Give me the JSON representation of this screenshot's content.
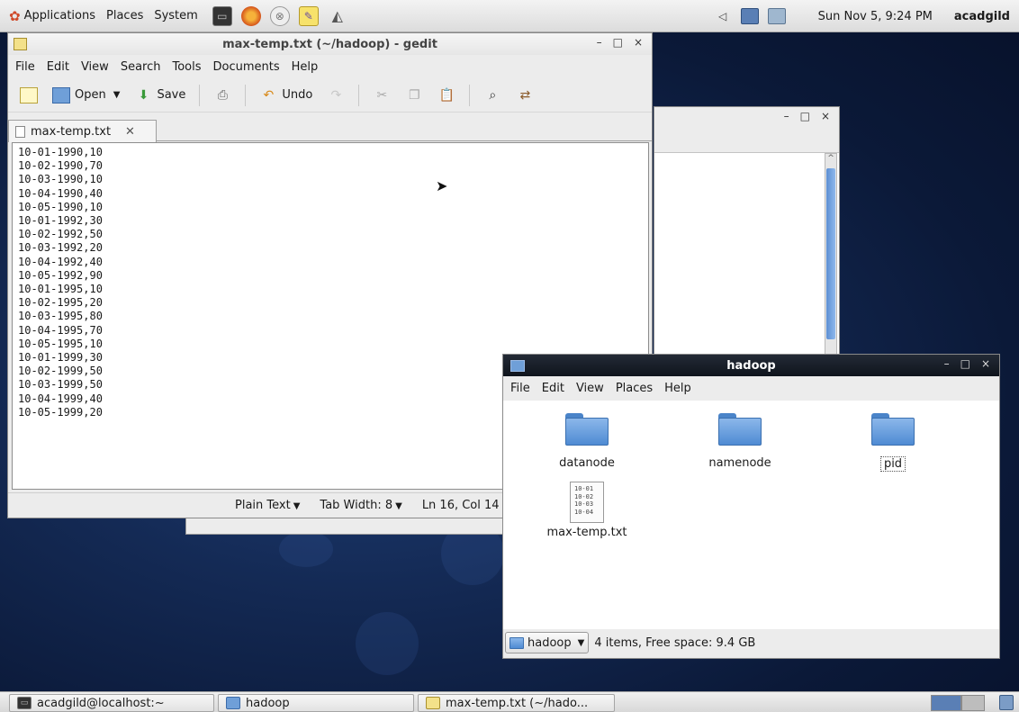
{
  "top_panel": {
    "menus": [
      "Applications",
      "Places",
      "System"
    ],
    "launchers": [
      "terminal-icon",
      "firefox-icon",
      "network-icon",
      "notes-icon",
      "dolphin-icon"
    ],
    "tray_icons": [
      "volume-icon",
      "network-manager-icon",
      "user-switcher-icon"
    ],
    "clock": "Sun Nov  5,  9:24 PM",
    "username": "acadgild"
  },
  "gedit": {
    "title": "max-temp.txt (~/hadoop) - gedit",
    "menus": [
      "File",
      "Edit",
      "View",
      "Search",
      "Tools",
      "Documents",
      "Help"
    ],
    "toolbar": {
      "open_label": "Open",
      "save_label": "Save",
      "undo_label": "Undo"
    },
    "tab_label": "max-temp.txt",
    "lines": [
      "10-01-1990,10",
      "10-02-1990,70",
      "10-03-1990,10",
      "10-04-1990,40",
      "10-05-1990,10",
      "10-01-1992,30",
      "10-02-1992,50",
      "10-03-1992,20",
      "10-04-1992,40",
      "10-05-1992,90",
      "10-01-1995,10",
      "10-02-1995,20",
      "10-03-1995,80",
      "10-04-1995,70",
      "10-05-1995,10",
      "10-01-1999,30",
      "10-02-1999,50",
      "10-03-1999,50",
      "10-04-1999,40",
      "10-05-1999,20"
    ],
    "status": {
      "language": "Plain Text",
      "tab_width": "Tab Width:  8",
      "position": "Ln 16, Col 14"
    }
  },
  "file_manager": {
    "title": "hadoop",
    "menus": [
      "File",
      "Edit",
      "View",
      "Places",
      "Help"
    ],
    "items": [
      {
        "name": "datanode",
        "type": "folder"
      },
      {
        "name": "namenode",
        "type": "folder"
      },
      {
        "name": "pid",
        "type": "folder"
      },
      {
        "name": "max-temp.txt",
        "type": "text-file"
      }
    ],
    "file_preview_lines": [
      "10-01",
      "10-02",
      "10-03",
      "10-04"
    ],
    "location": "hadoop",
    "status": "4 items, Free space: 9.4 GB"
  },
  "taskbar": {
    "tasks": [
      "acadgild@localhost:~",
      "hadoop",
      "max-temp.txt (~/hado..."
    ]
  },
  "colors": {
    "desktop": "#142a55",
    "folder_blue": "#4f8bd3",
    "fm_titlebar": "#1a202a"
  }
}
